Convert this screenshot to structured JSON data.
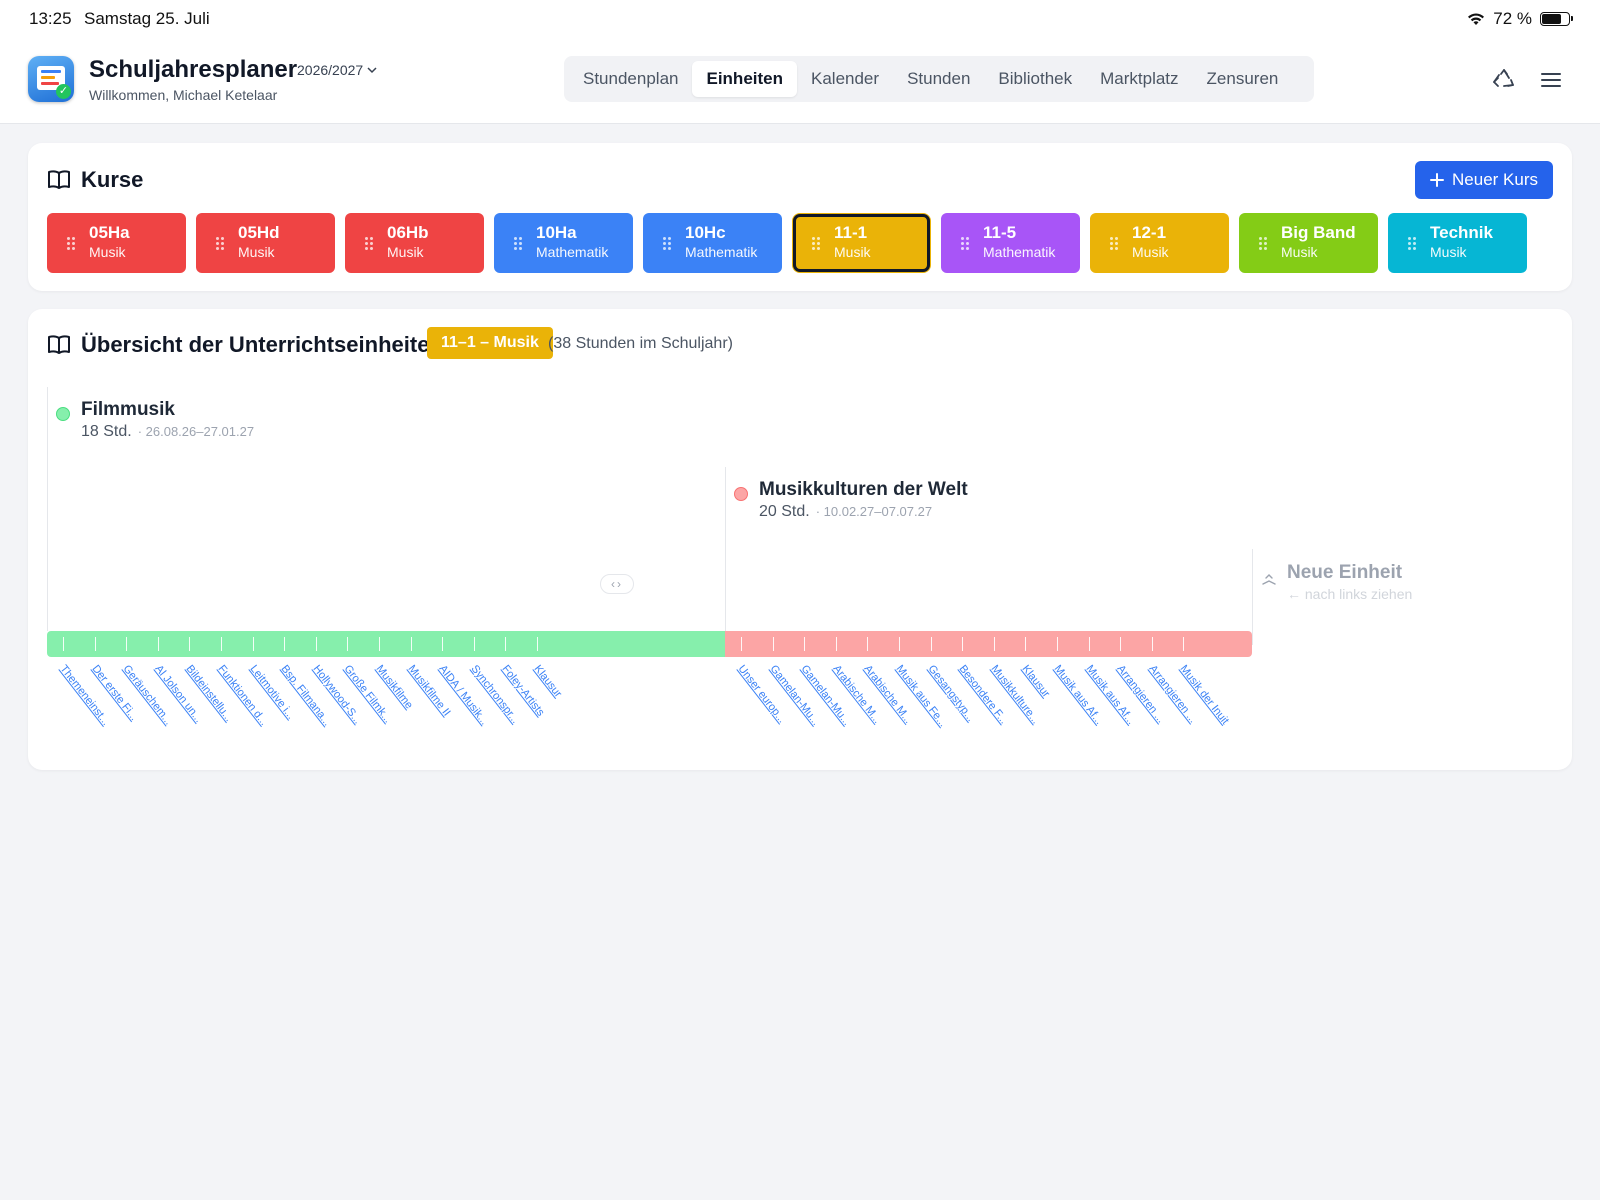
{
  "status": {
    "time": "13:25",
    "date": "Samstag 25. Juli",
    "battery": "72 %",
    "battery_level": 0.72
  },
  "header": {
    "title": "Schuljahresplaner",
    "welcome": "Willkommen, Michael Ketelaar",
    "year": "2026/2027",
    "tabs": [
      "Stundenplan",
      "Einheiten",
      "Kalender",
      "Stunden",
      "Bibliothek",
      "Marktplatz",
      "Zensuren"
    ],
    "active_tab": "Einheiten"
  },
  "courses_card": {
    "title": "Kurse",
    "new_button": "Neuer Kurs",
    "courses": [
      {
        "name": "05Ha",
        "subject": "Musik",
        "color": "#ef4444"
      },
      {
        "name": "05Hd",
        "subject": "Musik",
        "color": "#ef4444"
      },
      {
        "name": "06Hb",
        "subject": "Musik",
        "color": "#ef4444"
      },
      {
        "name": "10Ha",
        "subject": "Mathematik",
        "color": "#3b82f6"
      },
      {
        "name": "10Hc",
        "subject": "Mathematik",
        "color": "#3b82f6"
      },
      {
        "name": "11-1",
        "subject": "Musik",
        "color": "#eab308",
        "selected": true
      },
      {
        "name": "11-5",
        "subject": "Mathematik",
        "color": "#a855f7"
      },
      {
        "name": "12-1",
        "subject": "Musik",
        "color": "#eab308"
      },
      {
        "name": "Big Band",
        "subject": "Musik",
        "color": "#84cc16"
      },
      {
        "name": "Technik",
        "subject": "Musik",
        "color": "#06b6d4"
      }
    ]
  },
  "overview": {
    "title": "Übersicht der Unterrichtseinheiten",
    "badge": "11–1 – Musik",
    "hours_note": "(38 Stunden im Schuljahr)",
    "units": [
      {
        "name": "Filmmusik",
        "hours": "18 Std.",
        "dates": "· 26.08.26–27.01.27",
        "dot_color": "#86efac",
        "dot_border": "#4ade80",
        "bar_color": "#86efac",
        "lessons": [
          "Themeneinst...",
          "Der erste Fi...",
          "Geräuschem...",
          "Al Jolson un...",
          "Bildeinstellu...",
          "Funktionen d...",
          "Leitmotive i...",
          "Bsp. Filmana...",
          "Hollywood-S...",
          "Große Filmk...",
          "Musikfilme",
          "Musikfilme II",
          "AIDA / Musik...",
          "Synchronspr...",
          "Foley-Artists",
          "Klausur"
        ]
      },
      {
        "name": "Musikkulturen der Welt",
        "hours": "20 Std.",
        "dates": "· 10.02.27–07.07.27",
        "dot_color": "#fca5a5",
        "dot_border": "#f87171",
        "bar_color": "#fca5a5",
        "lessons": [
          "Unser europ...",
          "Gamelan-Mu...",
          "Gamelan-Mu...",
          "Arabische M...",
          "Arabische M...",
          "Musik aus Fe...",
          "Gesangstyp...",
          "Besondere F...",
          "Musikkulture...",
          "Klausur",
          "Musik aus Af...",
          "Musik aus Af...",
          "Arrangieren ...",
          "Arrangieren ...",
          "Musik der Inuit"
        ]
      }
    ],
    "new_unit": {
      "name": "Neue Einheit",
      "hint": "← nach links ziehen"
    }
  }
}
